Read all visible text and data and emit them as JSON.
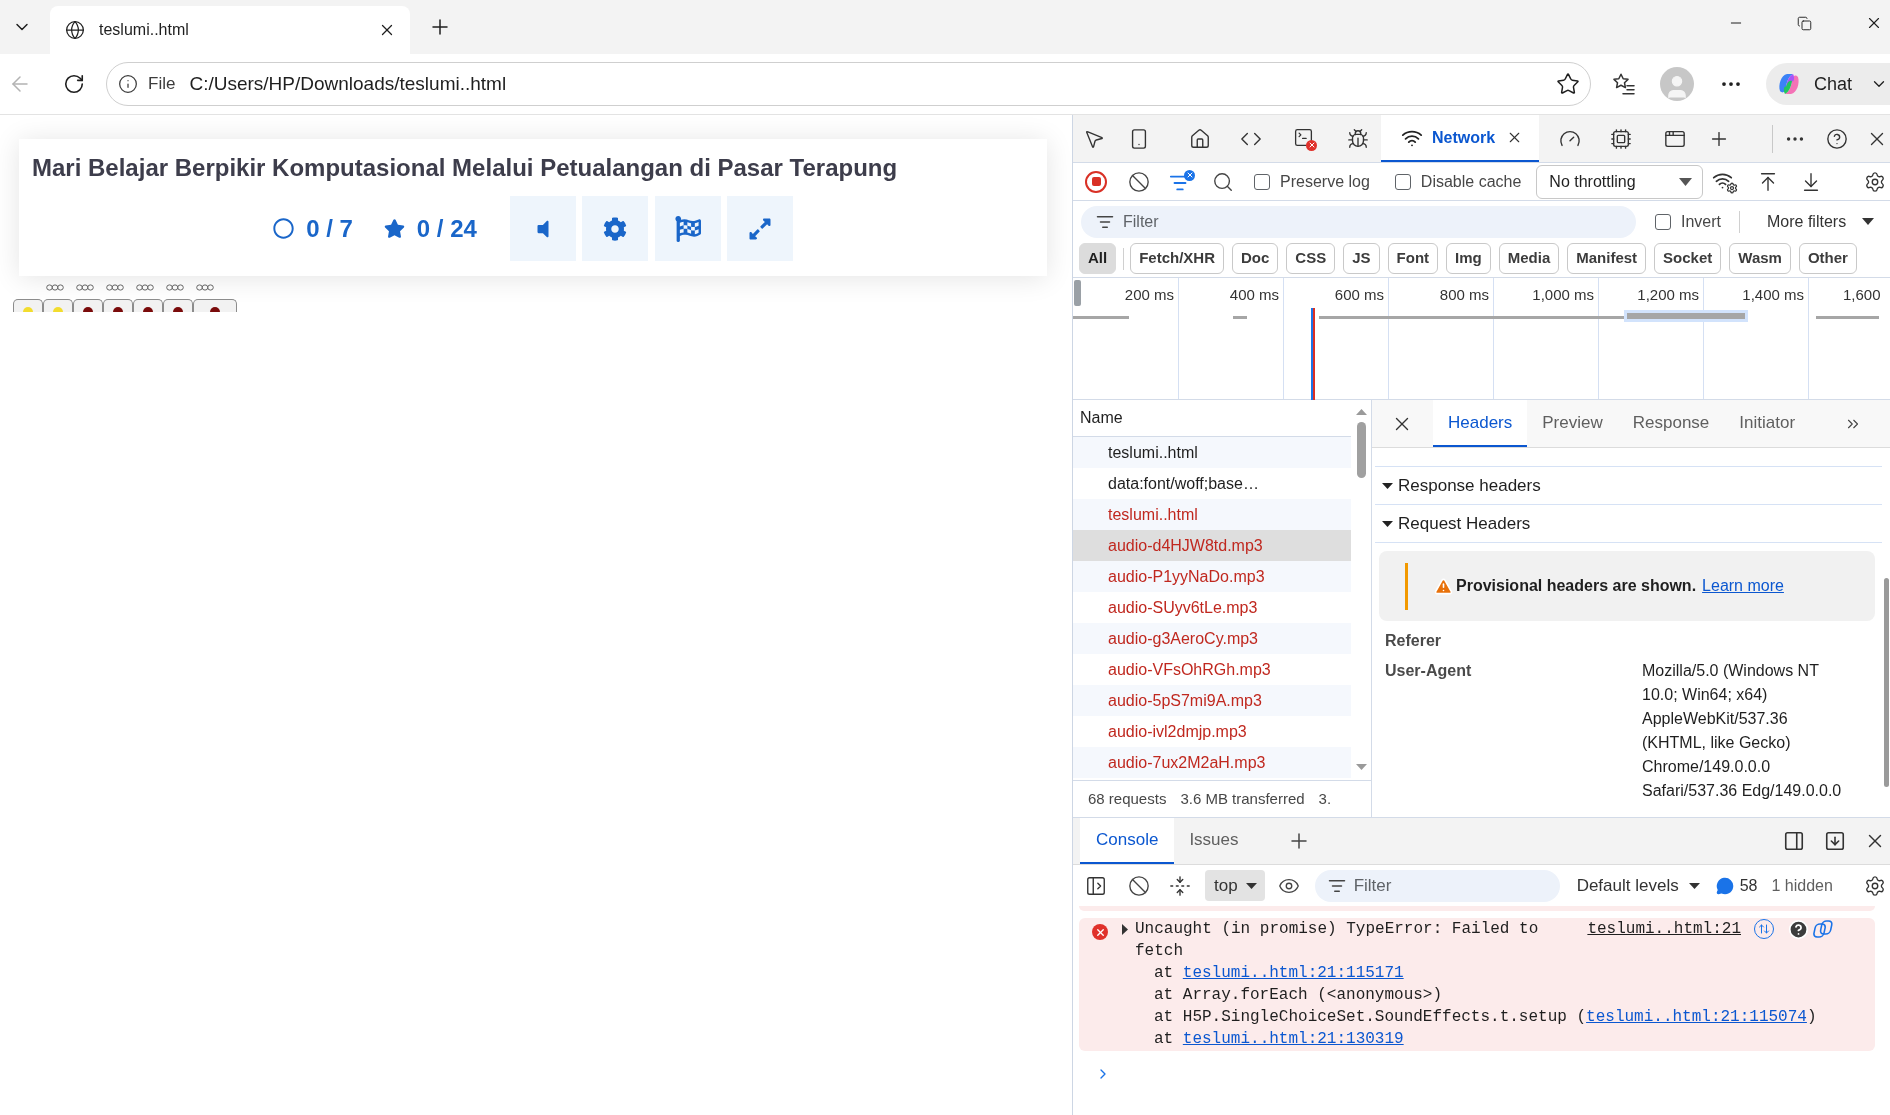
{
  "browser": {
    "tabs": [
      {
        "title": "teslumi..html",
        "selected": true
      }
    ],
    "address": {
      "scheme": "File",
      "url": "C:/Users/HP/Downloads/teslumi..html"
    },
    "chat_label": "Chat"
  },
  "page": {
    "title": "Mari Belajar Berpikir Komputasional Melalui Petualangan di Pasar Terapung",
    "counters": [
      {
        "kind": "answered",
        "text": "0 / 7"
      },
      {
        "kind": "score",
        "text": "0 / 24"
      }
    ],
    "markers": [
      {
        "color": "#f2dc2e"
      },
      {
        "color": "#f2dc2e"
      },
      {
        "color": "#7a0b0b"
      },
      {
        "color": "#7a0b0b"
      },
      {
        "color": "#7a0b0b"
      },
      {
        "color": "#7a0b0b"
      },
      {
        "color": "#7a0b0b"
      }
    ]
  },
  "devtools": {
    "panel_tabs": [
      {
        "label": "Network",
        "selected": true
      }
    ],
    "toolbar": {
      "options": [
        {
          "label": "Preserve log",
          "checked": false
        },
        {
          "label": "Disable cache",
          "checked": false
        }
      ],
      "throttling": "No throttling"
    },
    "filter": {
      "placeholder": "Filter",
      "invert": {
        "label": "Invert",
        "checked": false
      },
      "more_filters": "More filters"
    },
    "type_filters": [
      {
        "label": "All",
        "selected": true
      },
      {
        "label": "Fetch/XHR",
        "selected": false
      },
      {
        "label": "Doc",
        "selected": false
      },
      {
        "label": "CSS",
        "selected": false
      },
      {
        "label": "JS",
        "selected": false
      },
      {
        "label": "Font",
        "selected": false
      },
      {
        "label": "Img",
        "selected": false
      },
      {
        "label": "Media",
        "selected": false
      },
      {
        "label": "Manifest",
        "selected": false
      },
      {
        "label": "Socket",
        "selected": false
      },
      {
        "label": "Wasm",
        "selected": false
      },
      {
        "label": "Other",
        "selected": false
      }
    ],
    "timeline": {
      "ticks": [
        "200 ms",
        "400 ms",
        "600 ms",
        "800 ms",
        "1,000 ms",
        "1,200 ms",
        "1,400 ms",
        "1,600"
      ]
    },
    "requests": {
      "column": "Name",
      "rows": [
        {
          "name": "teslumi..html",
          "failed": false,
          "selected": false
        },
        {
          "name": "data:font/woff;base…",
          "failed": false,
          "selected": false
        },
        {
          "name": "teslumi..html",
          "failed": true,
          "selected": false
        },
        {
          "name": "audio-d4HJW8td.mp3",
          "failed": true,
          "selected": true
        },
        {
          "name": "audio-P1yyNaDo.mp3",
          "failed": true,
          "selected": false
        },
        {
          "name": "audio-SUyv6tLe.mp3",
          "failed": true,
          "selected": false
        },
        {
          "name": "audio-g3AeroCy.mp3",
          "failed": true,
          "selected": false
        },
        {
          "name": "audio-VFsOhRGh.mp3",
          "failed": true,
          "selected": false
        },
        {
          "name": "audio-5pS7mi9A.mp3",
          "failed": true,
          "selected": false
        },
        {
          "name": "audio-ivl2dmjp.mp3",
          "failed": true,
          "selected": false
        },
        {
          "name": "audio-7ux2M2aH.mp3",
          "failed": true,
          "selected": false
        }
      ],
      "summary": [
        "68 requests",
        "3.6 MB transferred",
        "3."
      ]
    },
    "detail": {
      "tabs": [
        {
          "label": "Headers",
          "selected": true
        },
        {
          "label": "Preview",
          "selected": false
        },
        {
          "label": "Response",
          "selected": false
        },
        {
          "label": "Initiator",
          "selected": false
        }
      ],
      "sections": [
        {
          "title": "Response headers",
          "expanded": true
        },
        {
          "title": "Request Headers",
          "expanded": true
        }
      ],
      "warning": {
        "text": "Provisional headers are shown.",
        "link": "Learn more"
      },
      "headers": [
        {
          "name": "Referer"
        },
        {
          "name": "User-Agent",
          "value": "Mozilla/5.0 (Windows NT 10.0; Win64; x64) AppleWebKit/537.36 (KHTML, like Gecko) Chrome/149.0.0.0 Safari/537.36 Edg/149.0.0.0"
        }
      ]
    }
  },
  "drawer": {
    "tabs": [
      {
        "label": "Console",
        "selected": true
      },
      {
        "label": "Issues",
        "selected": false
      }
    ],
    "context": "top",
    "filter_placeholder": "Filter",
    "levels": "Default levels",
    "message_count": "58",
    "hidden": "1 hidden",
    "messages": [
      {
        "kind": "error",
        "text": "Uncaught (in promise) TypeError: Failed to fetch",
        "source": "teslumi..html:21",
        "stack": [
          {
            "before": "at ",
            "link": "teslumi..html:21:115171"
          },
          {
            "before": "at Array.forEach (<anonymous>)"
          },
          {
            "before": "at H5P.SingleChoiceSet.SoundEffects.t.setup (",
            "link": "teslumi..html:21:115074",
            "after": ")"
          },
          {
            "before": "at ",
            "link": "teslumi..html:21:130319"
          }
        ]
      }
    ]
  }
}
